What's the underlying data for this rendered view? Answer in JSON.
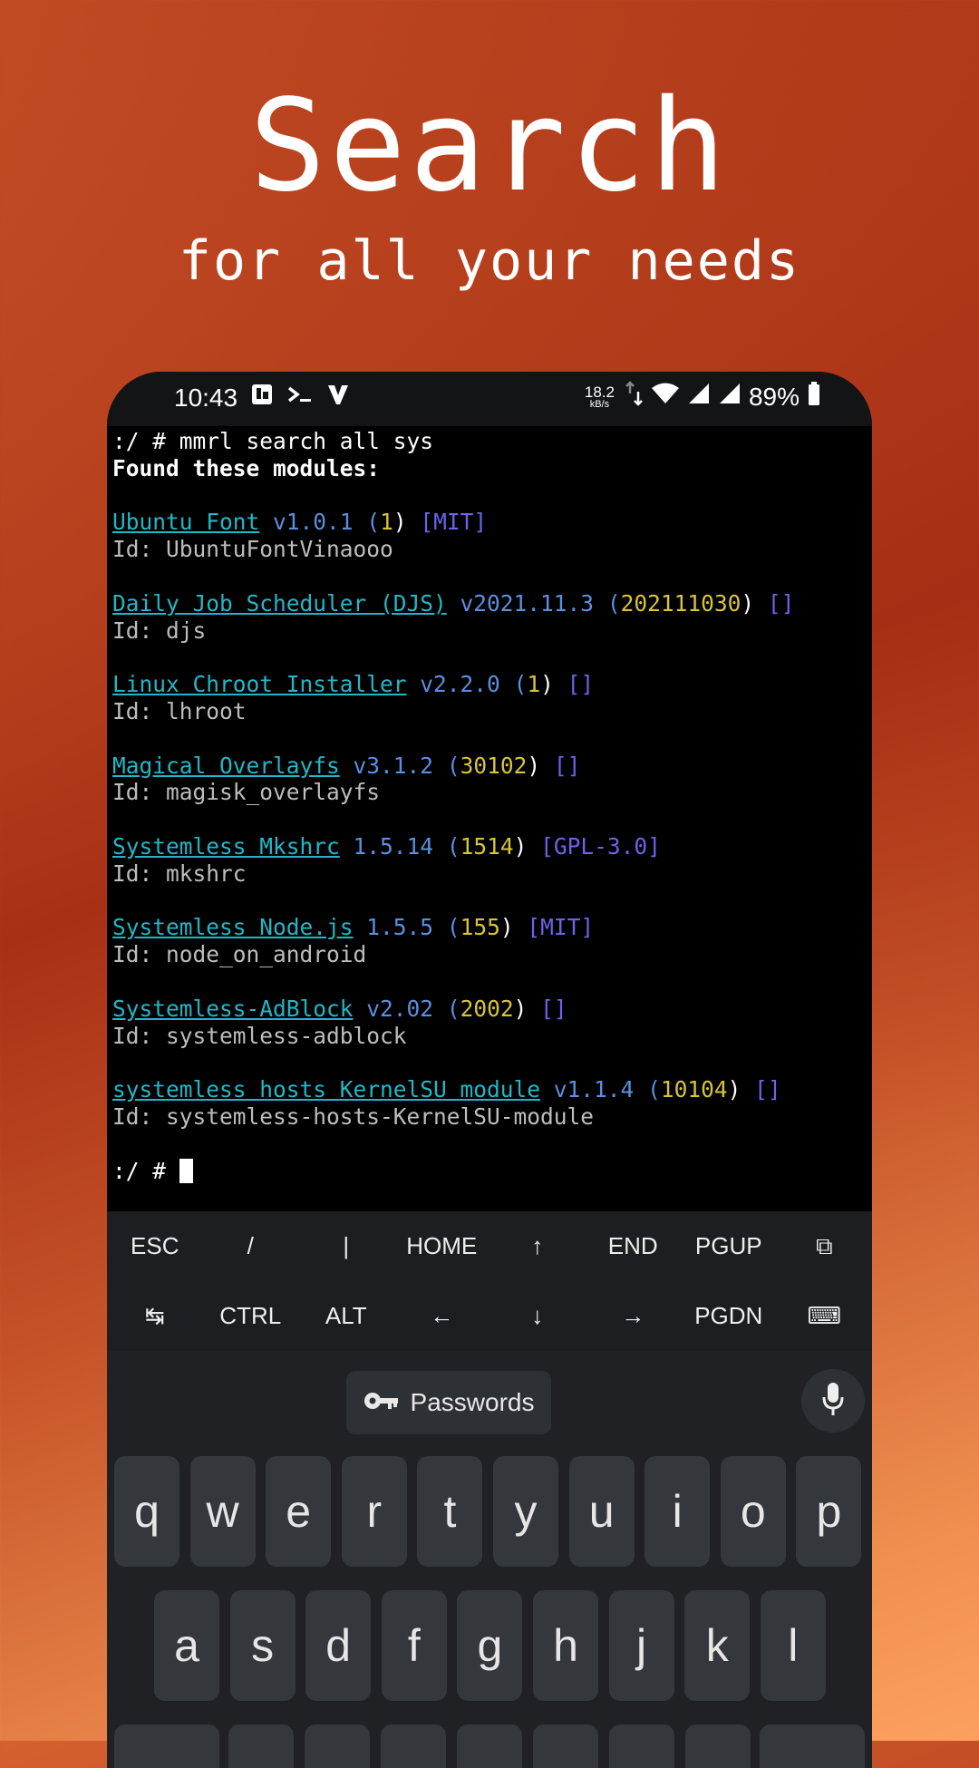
{
  "promo": {
    "headline": "Search",
    "subheadline": "for all your needs"
  },
  "statusbar": {
    "time": "10:43",
    "net_speed": "18.2",
    "net_unit": "kB/s",
    "battery": "89%"
  },
  "terminal": {
    "command": ":/ # mmrl search all sys",
    "found_label": "Found these modules:",
    "modules": [
      {
        "name": "Ubuntu Font",
        "version": "v1.0.1",
        "code": "1",
        "license": "[MIT]",
        "id": "Id: UbuntuFontVinaooo"
      },
      {
        "name": "Daily Job Scheduler (DJS)",
        "version": "v2021.11.3",
        "code": "202111030",
        "license": "[]",
        "id": "Id: djs"
      },
      {
        "name": "Linux Chroot Installer",
        "version": "v2.2.0",
        "code": "1",
        "license": "[]",
        "id": "Id: lhroot"
      },
      {
        "name": "Magical Overlayfs",
        "version": "v3.1.2",
        "code": "30102",
        "license": "[]",
        "id": "Id: magisk_overlayfs"
      },
      {
        "name": "Systemless Mkshrc",
        "version": "1.5.14",
        "code": "1514",
        "license": "[GPL-3.0]",
        "id": "Id: mkshrc"
      },
      {
        "name": "Systemless Node.js",
        "version": "1.5.5",
        "code": "155",
        "license": "[MIT]",
        "id": "Id: node_on_android"
      },
      {
        "name": "Systemless-AdBlock",
        "version": "v2.02",
        "code": "2002",
        "license": "[]",
        "id": "Id: systemless-adblock"
      },
      {
        "name": "systemless hosts KernelSU module",
        "version": "v1.1.4",
        "code": "10104",
        "license": "[]",
        "id": "Id: systemless-hosts-KernelSU-module"
      }
    ],
    "prompt": ":/ # "
  },
  "extra_keys": {
    "row1": [
      "ESC",
      "/",
      "|",
      "HOME",
      "↑",
      "END",
      "PGUP",
      "⧉"
    ],
    "row2": [
      "↹",
      "CTRL",
      "ALT",
      "←",
      "↓",
      "→",
      "PGDN",
      "⌨"
    ]
  },
  "keyboard": {
    "suggestion_label": "Passwords",
    "row1": [
      "q",
      "w",
      "e",
      "r",
      "t",
      "y",
      "u",
      "i",
      "o",
      "p"
    ],
    "row2": [
      "a",
      "s",
      "d",
      "f",
      "g",
      "h",
      "j",
      "k",
      "l"
    ]
  }
}
